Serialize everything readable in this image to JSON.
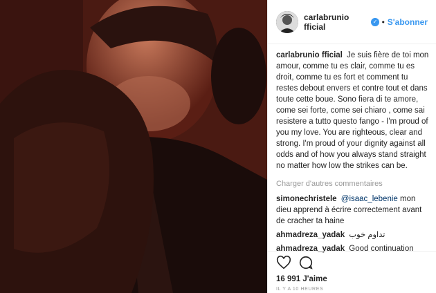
{
  "post": {
    "photo_alt": "",
    "author": {
      "username": "carlabrunio fficial",
      "verified_icon": "verified-check-icon",
      "follow_label": "S'abonner",
      "separator": "•"
    },
    "caption": {
      "username": "carlabrunio fficial",
      "text": "Je suis fière de toi mon amour, comme tu es clair, comme tu es droit, comme tu es fort  et comment tu restes debout envers et contre tout et dans toute cette boue. Sono fiera di te amore, come sei forte, come sei chiaro , come sai resistere a tutto questo fango - I'm proud of you my love. You are righteous, clear and strong. I'm proud of your dignity against all odds and of how you always stand straight no matter how low the strikes can be."
    },
    "load_more": "Charger d'autres commentaires",
    "comments": [
      {
        "username": "simonechristele",
        "mention": "@isaac_lebenie",
        "text": " mon dieu apprend à écrire correctement avant de cracher ta haine"
      },
      {
        "username": "ahmadreza_yadak",
        "mention": "",
        "text": "تداوم خوب"
      },
      {
        "username": "ahmadreza_yadak",
        "mention": "",
        "text": "Good continuation"
      }
    ],
    "likes": "16 991 J'aime",
    "timestamp": "IL Y A 10 HEURES",
    "icons": {
      "like": "heart-icon",
      "comment": "comment-icon"
    },
    "colors": {
      "link": "#3897f0",
      "text": "#262626",
      "muted": "#999999"
    }
  }
}
